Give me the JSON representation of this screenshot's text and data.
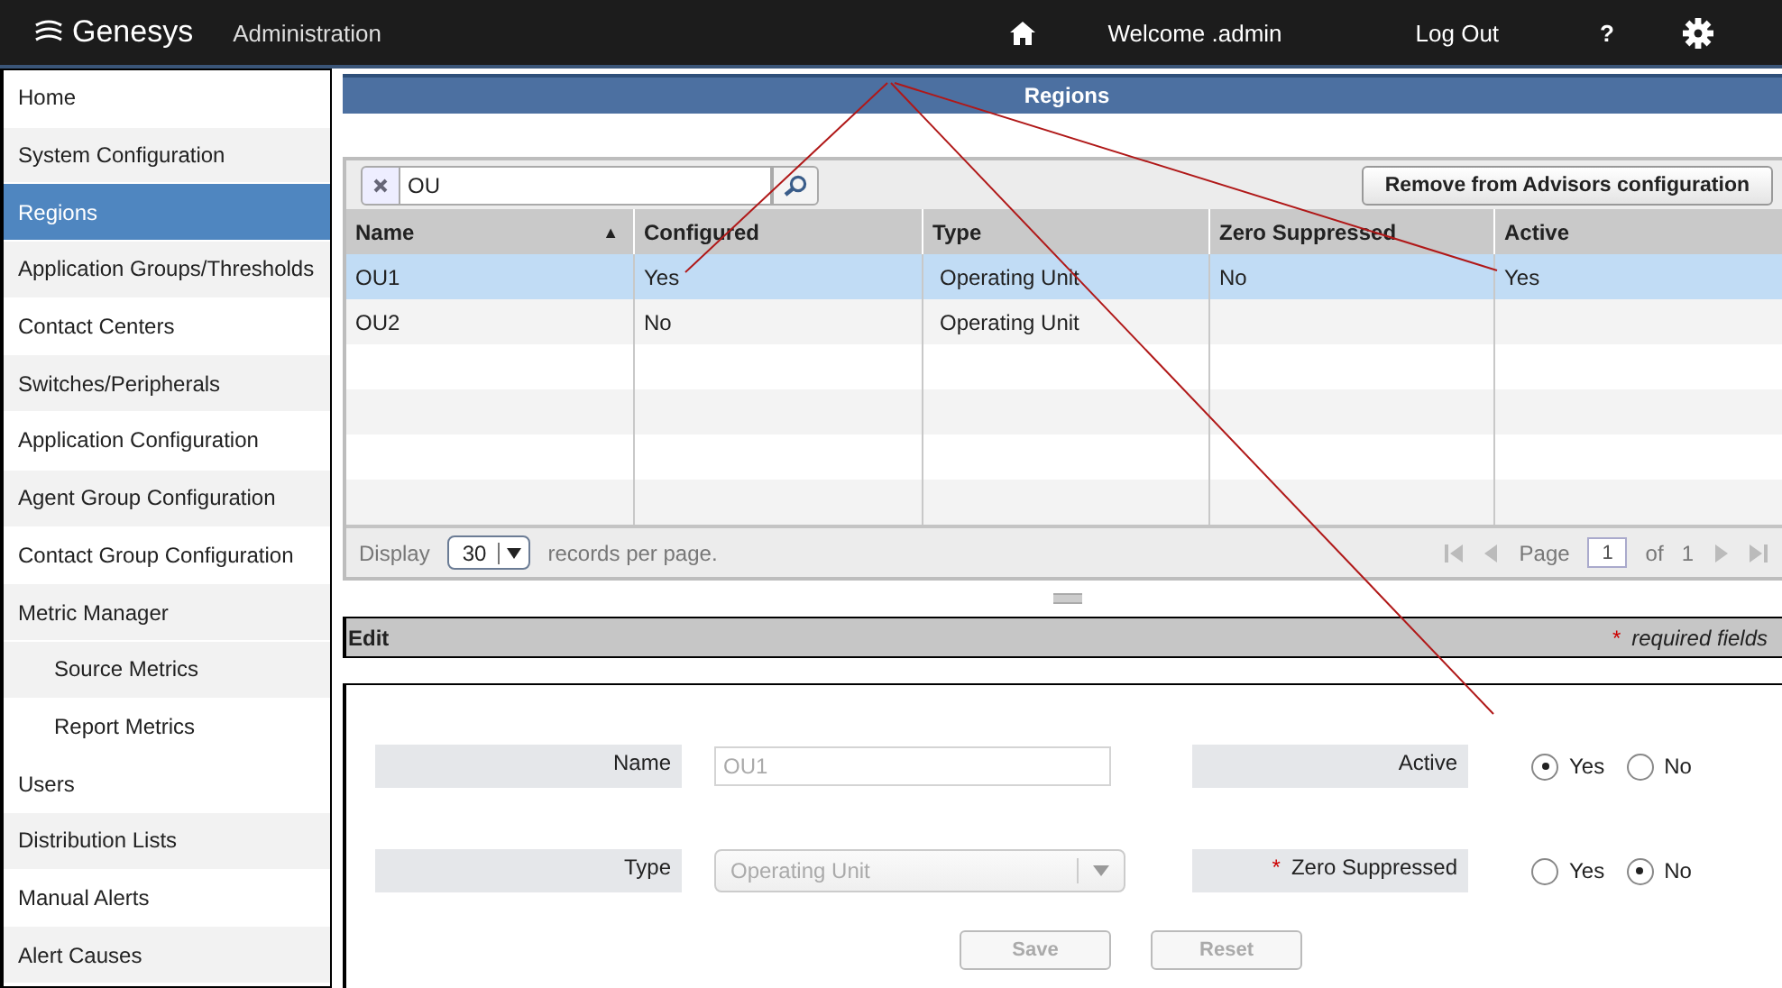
{
  "header": {
    "logo": "Genesys",
    "title": "Administration",
    "welcome": "Welcome .admin",
    "logout": "Log Out",
    "help": "?"
  },
  "sidebar": {
    "items": [
      {
        "label": "Home",
        "selected": false
      },
      {
        "label": "System Configuration",
        "selected": false
      },
      {
        "label": "Regions",
        "selected": true
      },
      {
        "label": "Application Groups/Thresholds",
        "selected": false
      },
      {
        "label": "Contact Centers",
        "selected": false
      },
      {
        "label": "Switches/Peripherals",
        "selected": false
      },
      {
        "label": "Application Configuration",
        "selected": false
      },
      {
        "label": "Agent Group Configuration",
        "selected": false
      },
      {
        "label": "Contact Group Configuration",
        "selected": false
      },
      {
        "label": "Metric Manager",
        "selected": false,
        "children": [
          {
            "label": "Source Metrics",
            "selected": false
          },
          {
            "label": "Report Metrics",
            "selected": false
          }
        ]
      },
      {
        "label": "Users",
        "selected": false
      },
      {
        "label": "Distribution Lists",
        "selected": false
      },
      {
        "label": "Manual Alerts",
        "selected": false
      },
      {
        "label": "Alert Causes",
        "selected": false
      }
    ]
  },
  "regions": {
    "title": "Regions",
    "search": {
      "value": "OU"
    },
    "remove_button": "Remove from Advisors configuration",
    "table": {
      "columns": [
        {
          "label": "Name",
          "sorted": true
        },
        {
          "label": "Configured",
          "sorted": false
        },
        {
          "label": "Type",
          "sorted": false
        },
        {
          "label": "Zero Suppressed",
          "sorted": false
        },
        {
          "label": "Active",
          "sorted": false
        }
      ],
      "sort_indicator": "▲",
      "rows": [
        {
          "cells": [
            "OU1",
            "Yes",
            "Operating Unit",
            "No",
            "Yes"
          ],
          "selected": true
        },
        {
          "cells": [
            "OU2",
            "No",
            "Operating Unit",
            "",
            ""
          ],
          "selected": false
        }
      ]
    },
    "pager": {
      "display_label": "Display",
      "page_size": "30",
      "per_page_label": "records per page.",
      "page_label": "Page",
      "page": "1",
      "of_label": "of",
      "total_pages": "1"
    }
  },
  "edit": {
    "title": "Edit",
    "required_mark": "*",
    "required_note": "required fields",
    "name": {
      "label": "Name",
      "value": "OU1",
      "disabled": true
    },
    "type": {
      "label": "Type",
      "value": "Operating Unit",
      "disabled": true
    },
    "active": {
      "label": "Active",
      "required": false,
      "options": [
        {
          "label": "Yes",
          "selected": true
        },
        {
          "label": "No",
          "selected": false
        }
      ]
    },
    "zero_suppressed": {
      "label": "Zero Suppressed",
      "required": true,
      "options": [
        {
          "label": "Yes",
          "selected": false
        },
        {
          "label": "No",
          "selected": true
        }
      ]
    },
    "buttons": [
      {
        "label": "Save",
        "disabled": true
      },
      {
        "label": "Reset",
        "disabled": true
      }
    ]
  }
}
